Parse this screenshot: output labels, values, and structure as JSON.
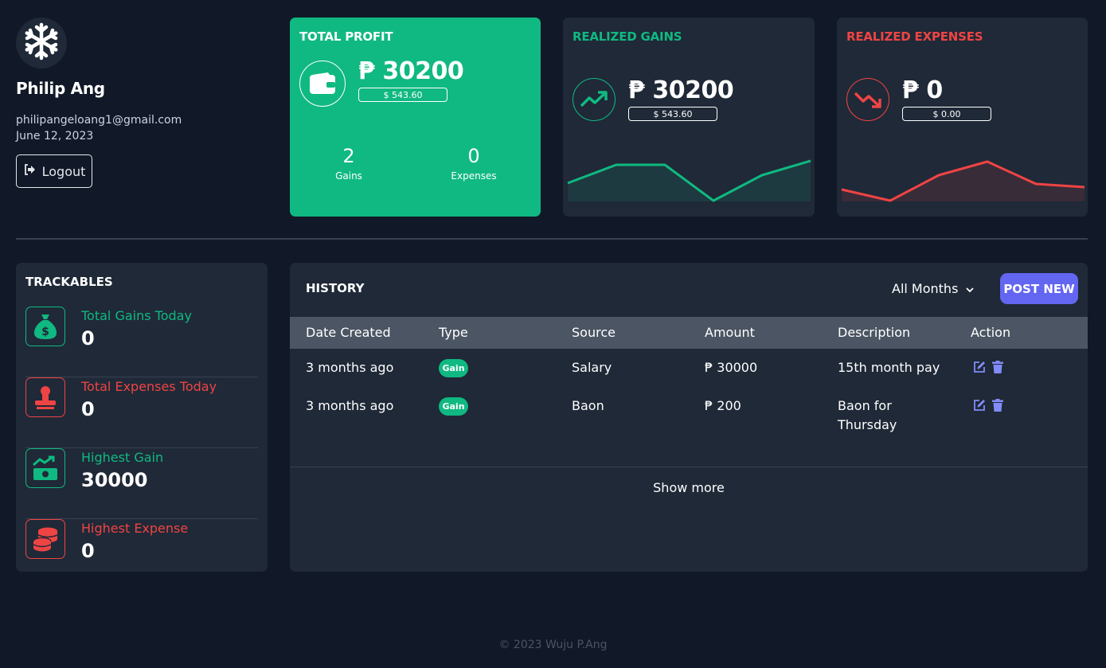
{
  "profile": {
    "name": "Philip Ang",
    "email": "philipangeloang1@gmail.com",
    "date": "June 12, 2023",
    "logout_label": "Logout"
  },
  "total_profit": {
    "title": "TOTAL PROFIT",
    "amount": "₱ 30200",
    "usd": "$ 543.60",
    "gains_count": "2",
    "gains_label": "Gains",
    "expenses_count": "0",
    "expenses_label": "Expenses"
  },
  "realized_gains": {
    "title": "REALIZED GAINS",
    "amount": "₱ 30200",
    "usd": "$ 543.60",
    "color": "#10b981"
  },
  "realized_expenses": {
    "title": "REALIZED EXPENSES",
    "amount": "₱ 0",
    "usd": "$ 0.00",
    "color": "#ef4444"
  },
  "trackables": {
    "title": "TRACKABLES",
    "items": [
      {
        "label": "Total Gains Today",
        "value": "0",
        "color": "#10b981",
        "icon": "money-bag-icon"
      },
      {
        "label": "Total Expenses Today",
        "value": "0",
        "color": "#ef4444",
        "icon": "stamp-icon"
      },
      {
        "label": "Highest Gain",
        "value": "30000",
        "color": "#10b981",
        "icon": "money-trend-icon"
      },
      {
        "label": "Highest Expense",
        "value": "0",
        "color": "#ef4444",
        "icon": "coins-stack-icon"
      }
    ]
  },
  "history": {
    "title": "HISTORY",
    "filter": "All Months",
    "post_label": "POST NEW",
    "columns": [
      "Date Created",
      "Type",
      "Source",
      "Amount",
      "Description",
      "Action"
    ],
    "rows": [
      {
        "date": "3 months ago",
        "type": "Gain",
        "source": "Salary",
        "amount": "₱ 30000",
        "description": "15th month pay"
      },
      {
        "date": "3 months ago",
        "type": "Gain",
        "source": "Baon",
        "amount": "₱ 200",
        "description": "Baon for Thursday"
      }
    ],
    "show_more": "Show more"
  },
  "footer": "© 2023 Wuju P.Ang",
  "colors": {
    "background": "#111827",
    "card": "#1f2937",
    "accent_green": "#10b981",
    "accent_red": "#ef4444",
    "accent_purple": "#6366f1"
  }
}
